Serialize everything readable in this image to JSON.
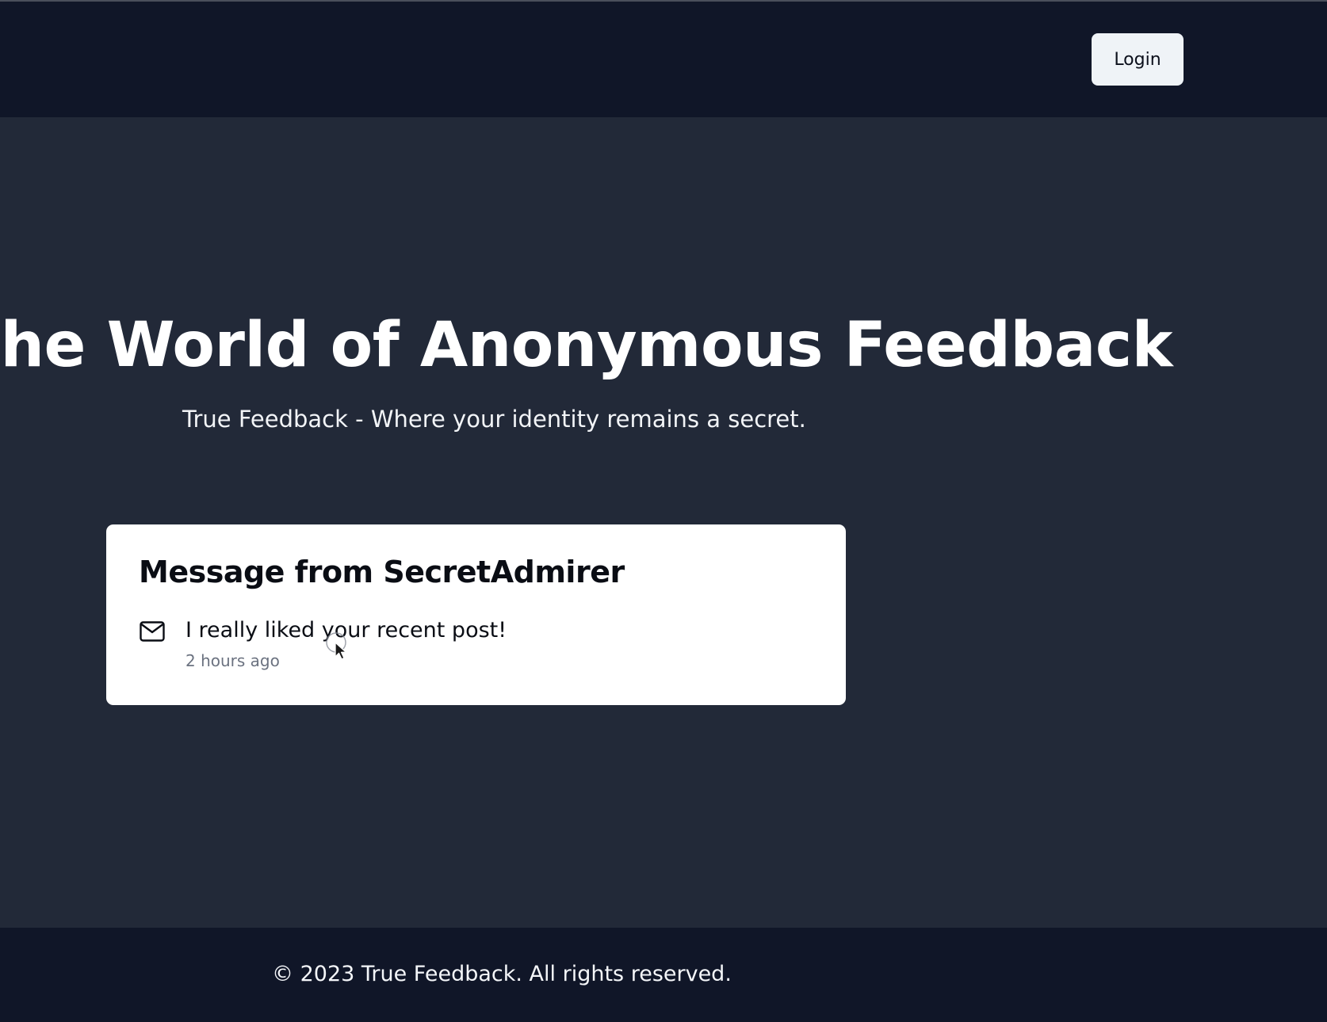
{
  "header": {
    "login_label": "Login"
  },
  "hero": {
    "title": "nto the World of Anonymous Feedback",
    "subtitle": "True Feedback - Where your identity remains a secret."
  },
  "message_card": {
    "title": "Message from SecretAdmirer",
    "icon": "mail-icon",
    "message": "I really liked your recent post!",
    "time": "2 hours ago"
  },
  "footer": {
    "copyright": "© 2023 True Feedback. All rights reserved."
  },
  "colors": {
    "header_bg": "#101628",
    "main_bg": "#222938",
    "card_bg": "#ffffff",
    "button_bg": "#eff3f7"
  }
}
